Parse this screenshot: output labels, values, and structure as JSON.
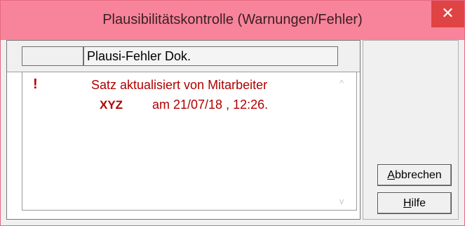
{
  "window": {
    "title": "Plausibilitätskontrolle (Warnungen/Fehler)",
    "close_symbol": "✕"
  },
  "list": {
    "column_header": "Plausi-Fehler Dok.",
    "items": [
      {
        "icon": "exclamation-icon",
        "icon_glyph": "!",
        "message_line1": "Satz aktualisiert von Mitarbeiter",
        "user": "XYZ",
        "message_line2": "am 21/07/18 , 12:26."
      }
    ],
    "scroll_up_glyph": "^",
    "scroll_down_glyph": "v"
  },
  "buttons": {
    "cancel_accel": "A",
    "cancel_rest": "bbrechen",
    "help_accel": "H",
    "help_rest": "ilfe"
  },
  "colors": {
    "titlebar": "#f7849a",
    "close": "#e04343",
    "error_text": "#b00000"
  }
}
